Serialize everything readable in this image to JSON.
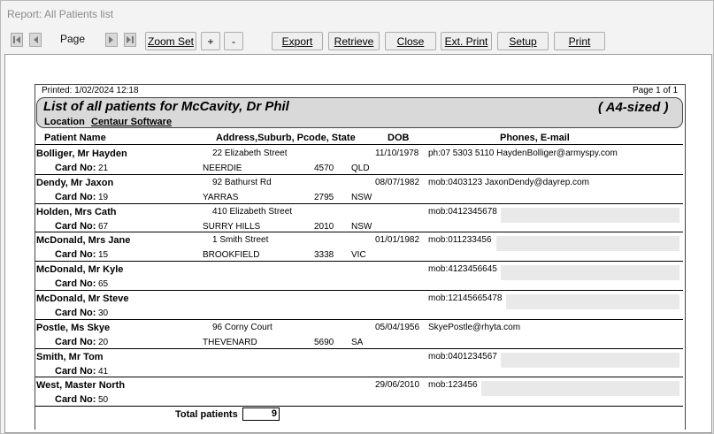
{
  "window": {
    "title": "Report: All Patients list"
  },
  "toolbar": {
    "page_label": "Page",
    "zoom_set_label": "Zoom Set",
    "zoom_in_label": "+",
    "zoom_out_label": "-",
    "export_label": "Export",
    "retrieve_label": "Retrieve",
    "close_label": "Close",
    "ext_print_label": "Ext. Print",
    "setup_label": "Setup",
    "print_label": "Print"
  },
  "report": {
    "printed": "Printed: 1/02/2024 12:18",
    "page_of": "Page 1 of 1",
    "title": "List of all patients for  McCavity, Dr Phil",
    "size_note": "( A4-sized )",
    "location_label": "Location",
    "location_value": "Centaur Software",
    "columns": {
      "patient_name": "Patient Name",
      "address": "Address,Suburb, Pcode, State",
      "dob": "DOB",
      "phones": "Phones, E-mail"
    },
    "card_label": "Card No:",
    "patients": [
      {
        "name": "Bolliger, Mr Hayden",
        "card": "21",
        "street": "22 Elizabeth Street",
        "suburb": "NEERDIE",
        "pcode": "4570",
        "state": "QLD",
        "dob": "11/10/1978",
        "contact": "ph:07 5303 5110 HaydenBolliger@armyspy.com",
        "redacted": false
      },
      {
        "name": "Dendy, Mr Jaxon",
        "card": "19",
        "street": "92 Bathurst Rd",
        "suburb": "YARRAS",
        "pcode": "2795",
        "state": "NSW",
        "dob": "08/07/1982",
        "contact": "mob:0403123 JaxonDendy@dayrep.com",
        "redacted": false
      },
      {
        "name": "Holden, Mrs Cath",
        "card": "67",
        "street": "410 Elizabeth Street",
        "suburb": "SURRY HILLS",
        "pcode": "2010",
        "state": "NSW",
        "dob": "",
        "contact": "mob:0412345678",
        "redacted": true
      },
      {
        "name": "McDonald, Mrs Jane",
        "card": "15",
        "street": "1 Smith Street",
        "suburb": "BROOKFIELD",
        "pcode": "3338",
        "state": "VIC",
        "dob": "01/01/1982",
        "contact": "mob:011233456",
        "redacted": true
      },
      {
        "name": "McDonald, Mr Kyle",
        "card": "65",
        "street": "",
        "suburb": "",
        "pcode": "",
        "state": "",
        "dob": "",
        "contact": "mob:4123456645",
        "redacted": true
      },
      {
        "name": "McDonald, Mr Steve",
        "card": "30",
        "street": "",
        "suburb": "",
        "pcode": "",
        "state": "",
        "dob": "",
        "contact": "mob:12145665478",
        "redacted": true
      },
      {
        "name": "Postle, Ms Skye",
        "card": "20",
        "street": "96 Corny Court",
        "suburb": "THEVENARD",
        "pcode": "5690",
        "state": "SA",
        "dob": "05/04/1956",
        "contact": "SkyePostle@rhyta.com",
        "redacted": false
      },
      {
        "name": "Smith, Mr Tom",
        "card": "41",
        "street": "",
        "suburb": "",
        "pcode": "",
        "state": "",
        "dob": "",
        "contact": "mob:0401234567",
        "redacted": true
      },
      {
        "name": "West, Master North",
        "card": "50",
        "street": "",
        "suburb": "",
        "pcode": "",
        "state": "",
        "dob": "29/06/2010",
        "contact": "mob:123456",
        "redacted": true
      }
    ],
    "total_label": "Total patients",
    "total_value": "9"
  }
}
